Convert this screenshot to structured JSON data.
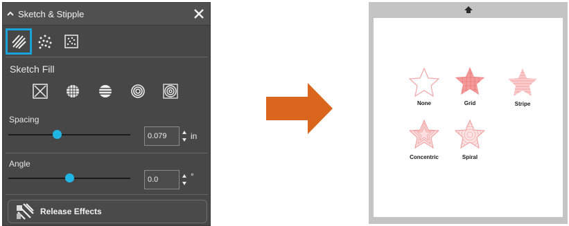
{
  "panel": {
    "title": "Sketch & Stipple",
    "tabs": [
      {
        "name": "sketch-tab",
        "icon": "sketch-lines-icon"
      },
      {
        "name": "stipple-tab",
        "icon": "stipple-dots-icon"
      },
      {
        "name": "stipple-fill-tab",
        "icon": "stipple-box-icon"
      }
    ],
    "section": "Sketch Fill",
    "fill_types": [
      "none-fill-icon",
      "grid-fill-icon",
      "stripe-fill-icon",
      "concentric-fill-icon",
      "spiral-fill-icon"
    ],
    "spacing": {
      "label": "Spacing",
      "value": "0.079",
      "unit": "in",
      "slider_level": 0.4
    },
    "angle": {
      "label": "Angle",
      "value": "0.0",
      "unit": "°",
      "slider_level": 0.5
    },
    "release_label": "Release Effects"
  },
  "colors": {
    "panel_bg": "#474747",
    "accent": "#1aa3d8",
    "slider_thumb": "#1fb6e6",
    "arrow": "#d9661c",
    "star_fill": "#f7b8b8",
    "star_outline": "#e8a0a0"
  },
  "preview": {
    "items": [
      {
        "label": "None",
        "pattern": "none"
      },
      {
        "label": "Grid",
        "pattern": "grid"
      },
      {
        "label": "Stripe",
        "pattern": "stripe"
      },
      {
        "label": "Concentric",
        "pattern": "concentric"
      },
      {
        "label": "Spiral",
        "pattern": "spiral"
      }
    ]
  }
}
